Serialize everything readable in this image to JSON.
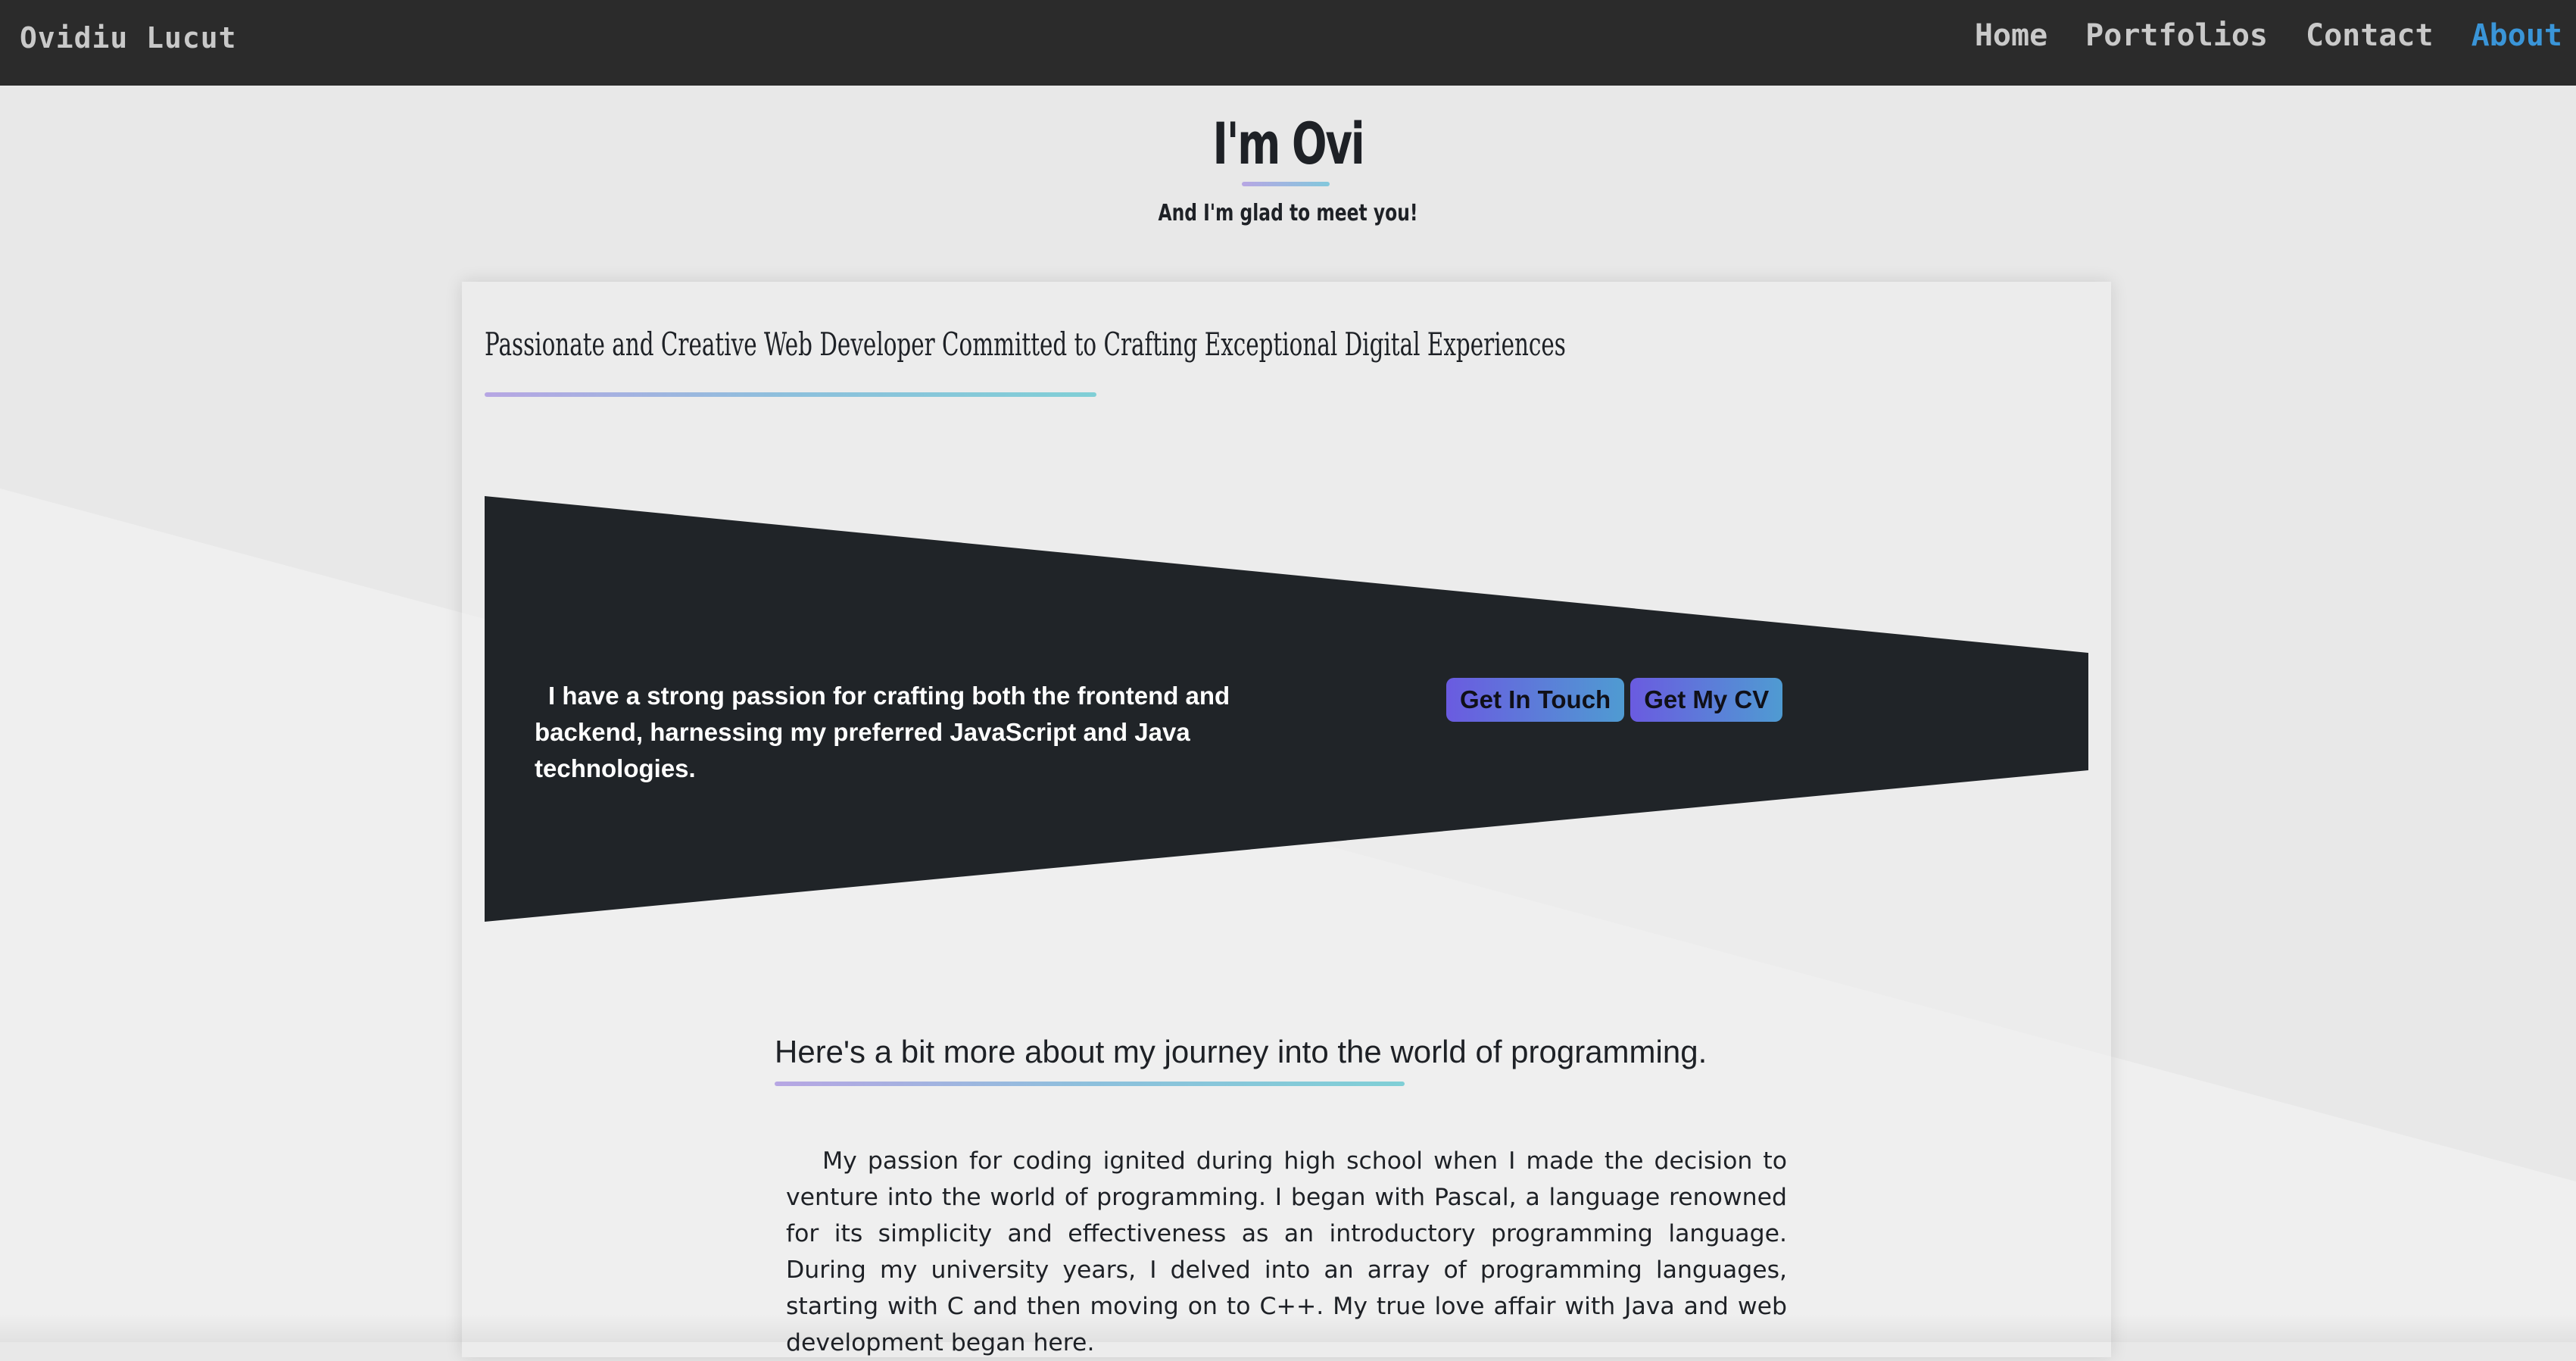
{
  "navbar": {
    "brand": "Ovidiu Lucut",
    "links": [
      {
        "label": "Home",
        "active": false
      },
      {
        "label": "Portfolios",
        "active": false
      },
      {
        "label": "Contact",
        "active": false
      },
      {
        "label": "About",
        "active": true
      }
    ]
  },
  "hero": {
    "title": "I'm Ovi",
    "subtitle": "And I'm glad to meet you!"
  },
  "card": {
    "heading": "Passionate and Creative Web Developer Committed to Crafting Exceptional Digital Experiences",
    "banner": {
      "text": "I have a strong passion for crafting both the frontend and backend, harnessing my preferred JavaScript and Java technologies.",
      "buttons": {
        "contact": "Get In Touch",
        "cv": "Get My CV"
      }
    },
    "journey": {
      "heading": "Here's a bit more about my journey into the world of programming.",
      "paragraph": "My passion for coding ignited during high school when I made the decision to venture into the world of programming. I began with Pascal, a language renowned for its simplicity and effectiveness as an introductory programming language. During my university years, I delved into an array of programming languages, starting with C and then moving on to C++. My true love affair with Java and web development began here."
    }
  },
  "colors": {
    "navbar_bg": "#2b2b2b",
    "nav_text": "#c9c9c9",
    "nav_active": "#3a95d8",
    "banner_bg": "#202428",
    "button_gradient_start": "#6a5be0",
    "button_gradient_end": "#4f9bd2",
    "underline_gradient_start": "#b7a6e3",
    "underline_gradient_end": "#80cfd6"
  }
}
